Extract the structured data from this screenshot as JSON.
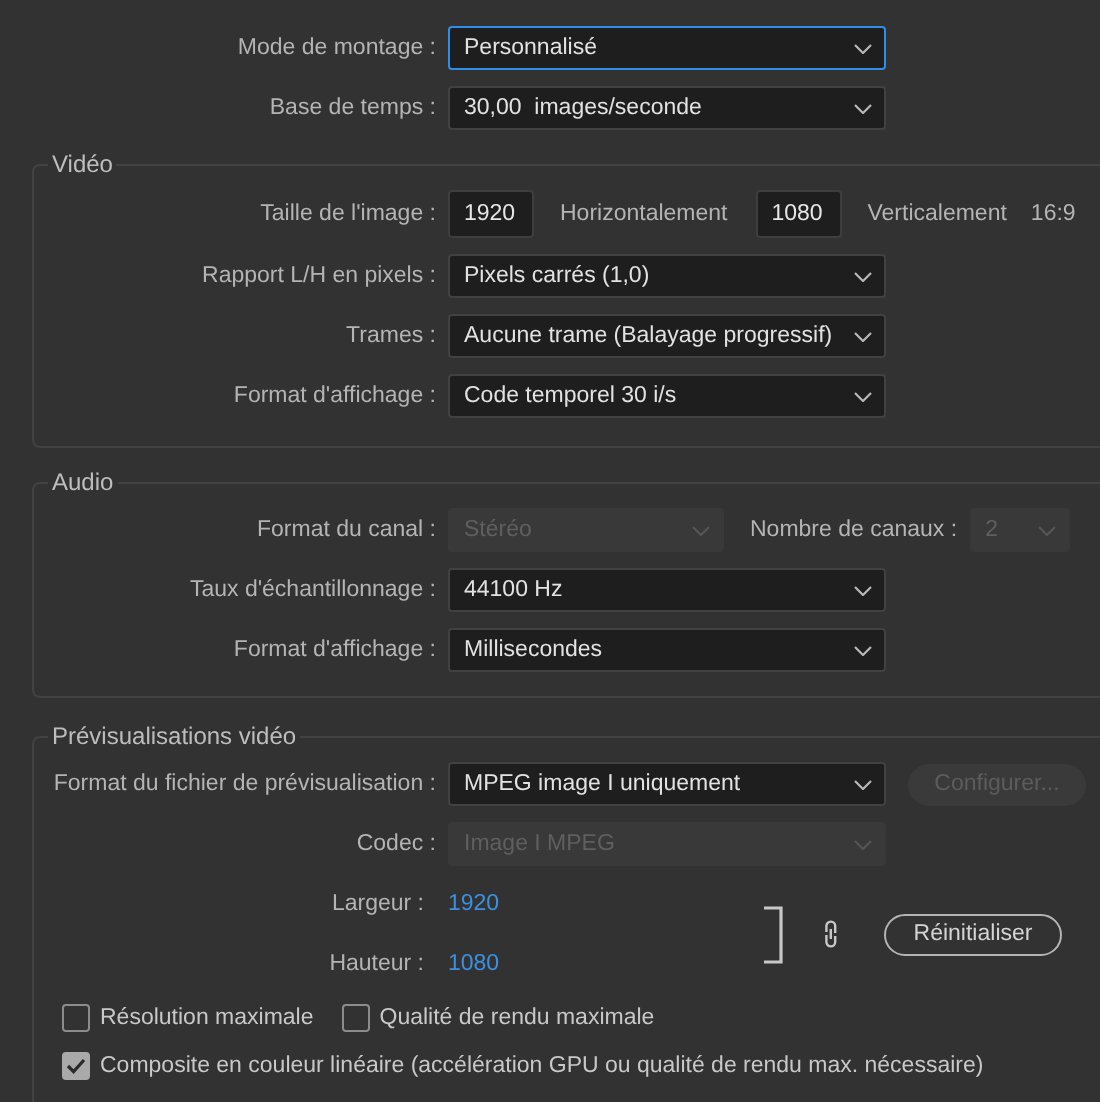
{
  "top_fields": [
    {
      "label": "Mode de montage :",
      "value": "Personnalisé",
      "focused": true,
      "disabled": false
    },
    {
      "label": "Base de temps :",
      "value": "30,00  images/seconde",
      "focused": false,
      "disabled": false
    }
  ],
  "video": {
    "title": "Vidéo",
    "frame_size": {
      "label": "Taille de l'image :",
      "horizontal": "1920",
      "horizontal_label": "Horizontalement",
      "vertical": "1080",
      "vertical_label": "Verticalement",
      "aspect": "16:9"
    },
    "fields": [
      {
        "label": "Rapport L/H en pixels :",
        "value": "Pixels carrés (1,0)",
        "focused": false,
        "disabled": false
      },
      {
        "label": "Trames :",
        "value": "Aucune trame (Balayage progressif)",
        "focused": false,
        "disabled": false
      },
      {
        "label": "Format d'affichage :",
        "value": "Code temporel 30 i/s",
        "focused": false,
        "disabled": false
      }
    ]
  },
  "audio": {
    "title": "Audio",
    "channel_format": {
      "label": "Format du canal :",
      "value": "Stéréo",
      "focused": false,
      "disabled": true
    },
    "channel_count": {
      "label": "Nombre de canaux :",
      "value": "2",
      "focused": false,
      "disabled": true
    },
    "fields": [
      {
        "label": "Taux d'échantillonnage :",
        "value": "44100 Hz",
        "focused": false,
        "disabled": false
      },
      {
        "label": "Format d'affichage :",
        "value": "Millisecondes",
        "focused": false,
        "disabled": false
      }
    ]
  },
  "previews": {
    "title": "Prévisualisations vidéo",
    "file_format": {
      "label": "Format du fichier de prévisualisation :",
      "value": "MPEG image I uniquement",
      "focused": false,
      "disabled": false
    },
    "configure_button": {
      "label": "Configurer...",
      "disabled": true
    },
    "codec": {
      "label": "Codec :",
      "value": "Image I MPEG",
      "focused": false,
      "disabled": true
    },
    "width": {
      "label": "Largeur :",
      "value": "1920"
    },
    "height": {
      "label": "Hauteur :",
      "value": "1080"
    },
    "reset_button": {
      "label": "Réinitialiser",
      "disabled": false
    },
    "checkbox_rows": [
      [
        {
          "label": "Résolution maximale",
          "checked": false
        },
        {
          "label": "Qualité de rendu maximale",
          "checked": false
        }
      ],
      [
        {
          "label": "Composite en couleur linéaire (accélération GPU ou qualité de rendu max. nécessaire)",
          "checked": true
        }
      ]
    ]
  }
}
